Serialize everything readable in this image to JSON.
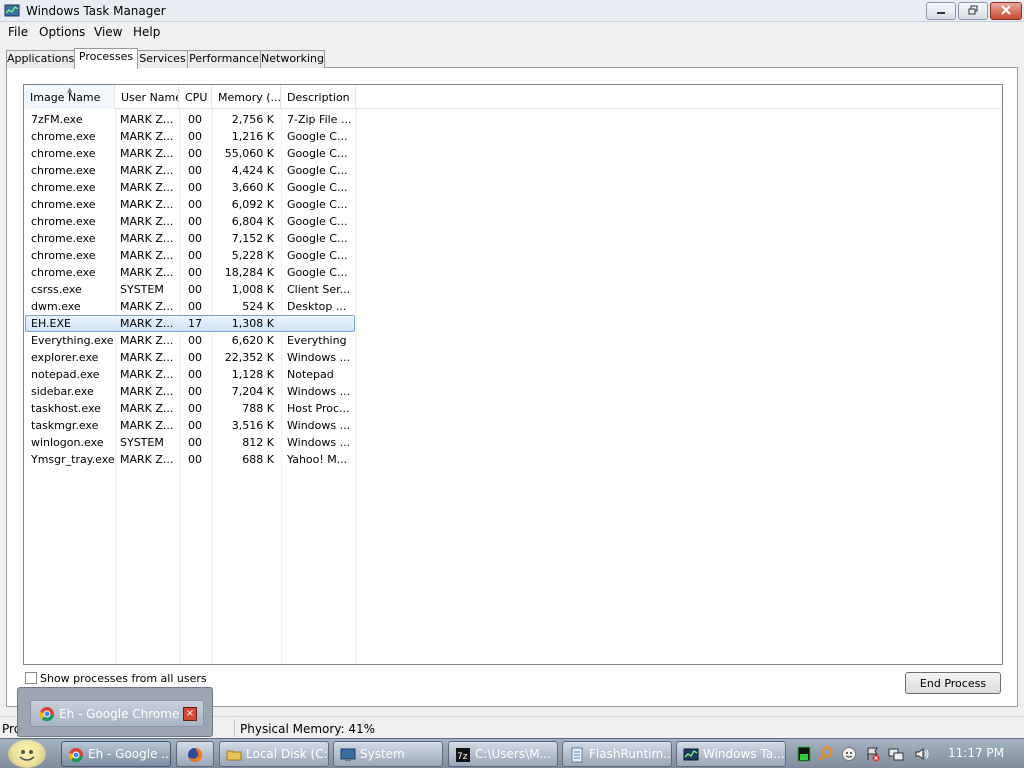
{
  "window": {
    "title": "Windows Task Manager"
  },
  "menu": [
    "File",
    "Options",
    "View",
    "Help"
  ],
  "tabs": [
    "Applications",
    "Processes",
    "Services",
    "Performance",
    "Networking"
  ],
  "active_tab": "Processes",
  "columns": [
    "Image Name",
    "User Name",
    "CPU",
    "Memory (...",
    "Description"
  ],
  "processes": [
    {
      "name": "7zFM.exe",
      "user": "MARK Z...",
      "cpu": "00",
      "mem": "2,756 K",
      "desc": "7-Zip File ..."
    },
    {
      "name": "chrome.exe",
      "user": "MARK Z...",
      "cpu": "00",
      "mem": "1,216 K",
      "desc": "Google C..."
    },
    {
      "name": "chrome.exe",
      "user": "MARK Z...",
      "cpu": "00",
      "mem": "55,060 K",
      "desc": "Google C..."
    },
    {
      "name": "chrome.exe",
      "user": "MARK Z...",
      "cpu": "00",
      "mem": "4,424 K",
      "desc": "Google C..."
    },
    {
      "name": "chrome.exe",
      "user": "MARK Z...",
      "cpu": "00",
      "mem": "3,660 K",
      "desc": "Google C..."
    },
    {
      "name": "chrome.exe",
      "user": "MARK Z...",
      "cpu": "00",
      "mem": "6,092 K",
      "desc": "Google C..."
    },
    {
      "name": "chrome.exe",
      "user": "MARK Z...",
      "cpu": "00",
      "mem": "6,804 K",
      "desc": "Google C..."
    },
    {
      "name": "chrome.exe",
      "user": "MARK Z...",
      "cpu": "00",
      "mem": "7,152 K",
      "desc": "Google C..."
    },
    {
      "name": "chrome.exe",
      "user": "MARK Z...",
      "cpu": "00",
      "mem": "5,228 K",
      "desc": "Google C..."
    },
    {
      "name": "chrome.exe",
      "user": "MARK Z...",
      "cpu": "00",
      "mem": "18,284 K",
      "desc": "Google C..."
    },
    {
      "name": "csrss.exe",
      "user": "SYSTEM",
      "cpu": "00",
      "mem": "1,008 K",
      "desc": "Client Ser..."
    },
    {
      "name": "dwm.exe",
      "user": "MARK Z...",
      "cpu": "00",
      "mem": "524 K",
      "desc": "Desktop ..."
    },
    {
      "name": "EH.EXE",
      "user": "MARK Z...",
      "cpu": "17",
      "mem": "1,308 K",
      "desc": "",
      "selected": true
    },
    {
      "name": "Everything.exe",
      "user": "MARK Z...",
      "cpu": "00",
      "mem": "6,620 K",
      "desc": "Everything"
    },
    {
      "name": "explorer.exe",
      "user": "MARK Z...",
      "cpu": "00",
      "mem": "22,352 K",
      "desc": "Windows ..."
    },
    {
      "name": "notepad.exe",
      "user": "MARK Z...",
      "cpu": "00",
      "mem": "1,128 K",
      "desc": "Notepad"
    },
    {
      "name": "sidebar.exe",
      "user": "MARK Z...",
      "cpu": "00",
      "mem": "7,204 K",
      "desc": "Windows ..."
    },
    {
      "name": "taskhost.exe",
      "user": "MARK Z...",
      "cpu": "00",
      "mem": "788 K",
      "desc": "Host Proc..."
    },
    {
      "name": "taskmgr.exe",
      "user": "MARK Z...",
      "cpu": "00",
      "mem": "3,516 K",
      "desc": "Windows ..."
    },
    {
      "name": "winlogon.exe",
      "user": "SYSTEM",
      "cpu": "00",
      "mem": "812 K",
      "desc": "Windows ..."
    },
    {
      "name": "Ymsgr_tray.exe",
      "user": "MARK Z...",
      "cpu": "00",
      "mem": "688 K",
      "desc": "Yahoo! M..."
    }
  ],
  "controls": {
    "show_all_label": "Show processes from all users",
    "end_process_label": "End Process"
  },
  "status": {
    "processes_prefix": "Pro",
    "physical_memory": "Physical Memory: 41%"
  },
  "popup": {
    "title": "Eh - Google Chrome",
    "close": "×"
  },
  "taskbar": {
    "buttons": [
      {
        "label": "Eh - Google ...",
        "icon": "chrome-icon",
        "active": true
      },
      {
        "label": "",
        "icon": "firefox-icon"
      },
      {
        "label": "Local Disk (C:)",
        "icon": "folder-icon"
      },
      {
        "label": "System",
        "icon": "system-icon"
      },
      {
        "label": "C:\\Users\\M...",
        "icon": "7zip-icon"
      },
      {
        "label": "FlashRuntim...",
        "icon": "notepad-icon"
      },
      {
        "label": "Windows Ta...",
        "icon": "taskmgr-icon"
      }
    ],
    "clock": "11:17 PM"
  },
  "colors": {
    "selection": "#cfe4fa",
    "selection_border": "#7da2ce",
    "taskbar": "#8f9cab"
  }
}
